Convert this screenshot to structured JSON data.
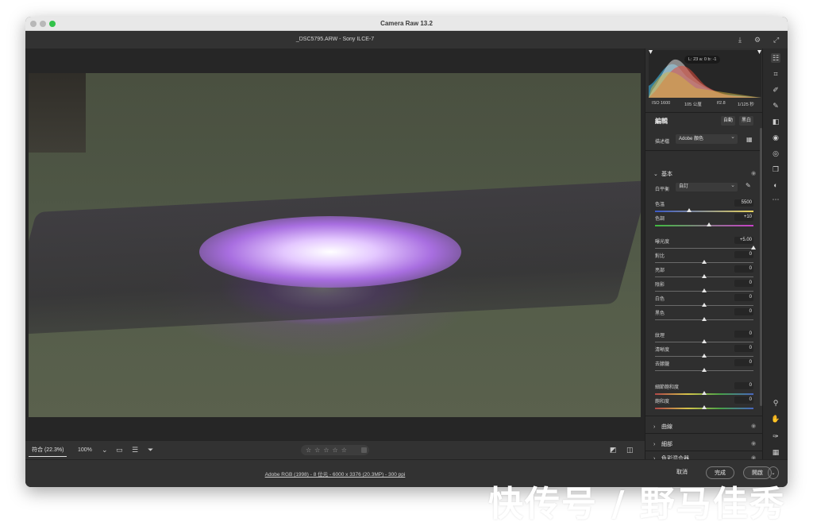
{
  "window": {
    "app_title": "Camera Raw 13.2"
  },
  "file": {
    "name": "_DSC5795.ARW  -  Sony ILCE-7"
  },
  "histogram": {
    "lab": "L: 23   a: 0   b: -1"
  },
  "exif": {
    "iso": "ISO 1600",
    "focal": "105 公厘",
    "aperture": "f/2.8",
    "shutter": "1/125 秒"
  },
  "edit": {
    "title": "編輯",
    "auto_label": "自動",
    "bw_label": "黑白",
    "profile_label": "描述檔",
    "profile_value": "Adobe 顏色",
    "basic_section": "基本",
    "wb_label": "白平衡",
    "wb_value": "自訂"
  },
  "sliders": [
    {
      "name": "temperature",
      "label": "色溫",
      "value": "5500",
      "level": 0.35,
      "track": "temp"
    },
    {
      "name": "tint",
      "label": "色調",
      "value": "+10",
      "level": 0.55,
      "track": "tint"
    },
    {
      "name": "exposure",
      "label": "曝光度",
      "value": "+5.00",
      "level": 1.0,
      "track": "plain"
    },
    {
      "name": "contrast",
      "label": "對比",
      "value": "0",
      "level": 0.5,
      "track": "plain"
    },
    {
      "name": "highlights",
      "label": "亮部",
      "value": "0",
      "level": 0.5,
      "track": "plain"
    },
    {
      "name": "shadows",
      "label": "陰影",
      "value": "0",
      "level": 0.5,
      "track": "plain"
    },
    {
      "name": "whites",
      "label": "白色",
      "value": "0",
      "level": 0.5,
      "track": "plain"
    },
    {
      "name": "blacks",
      "label": "黑色",
      "value": "0",
      "level": 0.5,
      "track": "plain"
    },
    {
      "name": "texture",
      "label": "紋理",
      "value": "0",
      "level": 0.5,
      "track": "plain"
    },
    {
      "name": "clarity",
      "label": "清晰度",
      "value": "0",
      "level": 0.5,
      "track": "plain"
    },
    {
      "name": "dehaze",
      "label": "去朦朧",
      "value": "0",
      "level": 0.5,
      "track": "plain"
    },
    {
      "name": "vibrance",
      "label": "細節飽和度",
      "value": "0",
      "level": 0.5,
      "track": "vib"
    },
    {
      "name": "saturation",
      "label": "飽和度",
      "value": "0",
      "level": 0.5,
      "track": "vib"
    }
  ],
  "sections": {
    "curve": "曲線",
    "detail": "細部",
    "color_mixer": "色彩混合器"
  },
  "bottom": {
    "zoom_fit": "符合 (22.3%)",
    "zoom_pct": "100%",
    "stars": "☆☆☆☆☆"
  },
  "footer": {
    "info": "Adobe RGB (1998) - 8 位元 - 6000 x 3376 (20.3MP) - 300 ppi",
    "cancel": "取消",
    "done": "完成",
    "open": "開啟",
    "caret": "⌄"
  },
  "watermark": "快传号 / 野马佳秀",
  "colors": {
    "bg": "#2b2b2b",
    "panel": "#2f2f2f",
    "accent": "#e6e6e6"
  }
}
